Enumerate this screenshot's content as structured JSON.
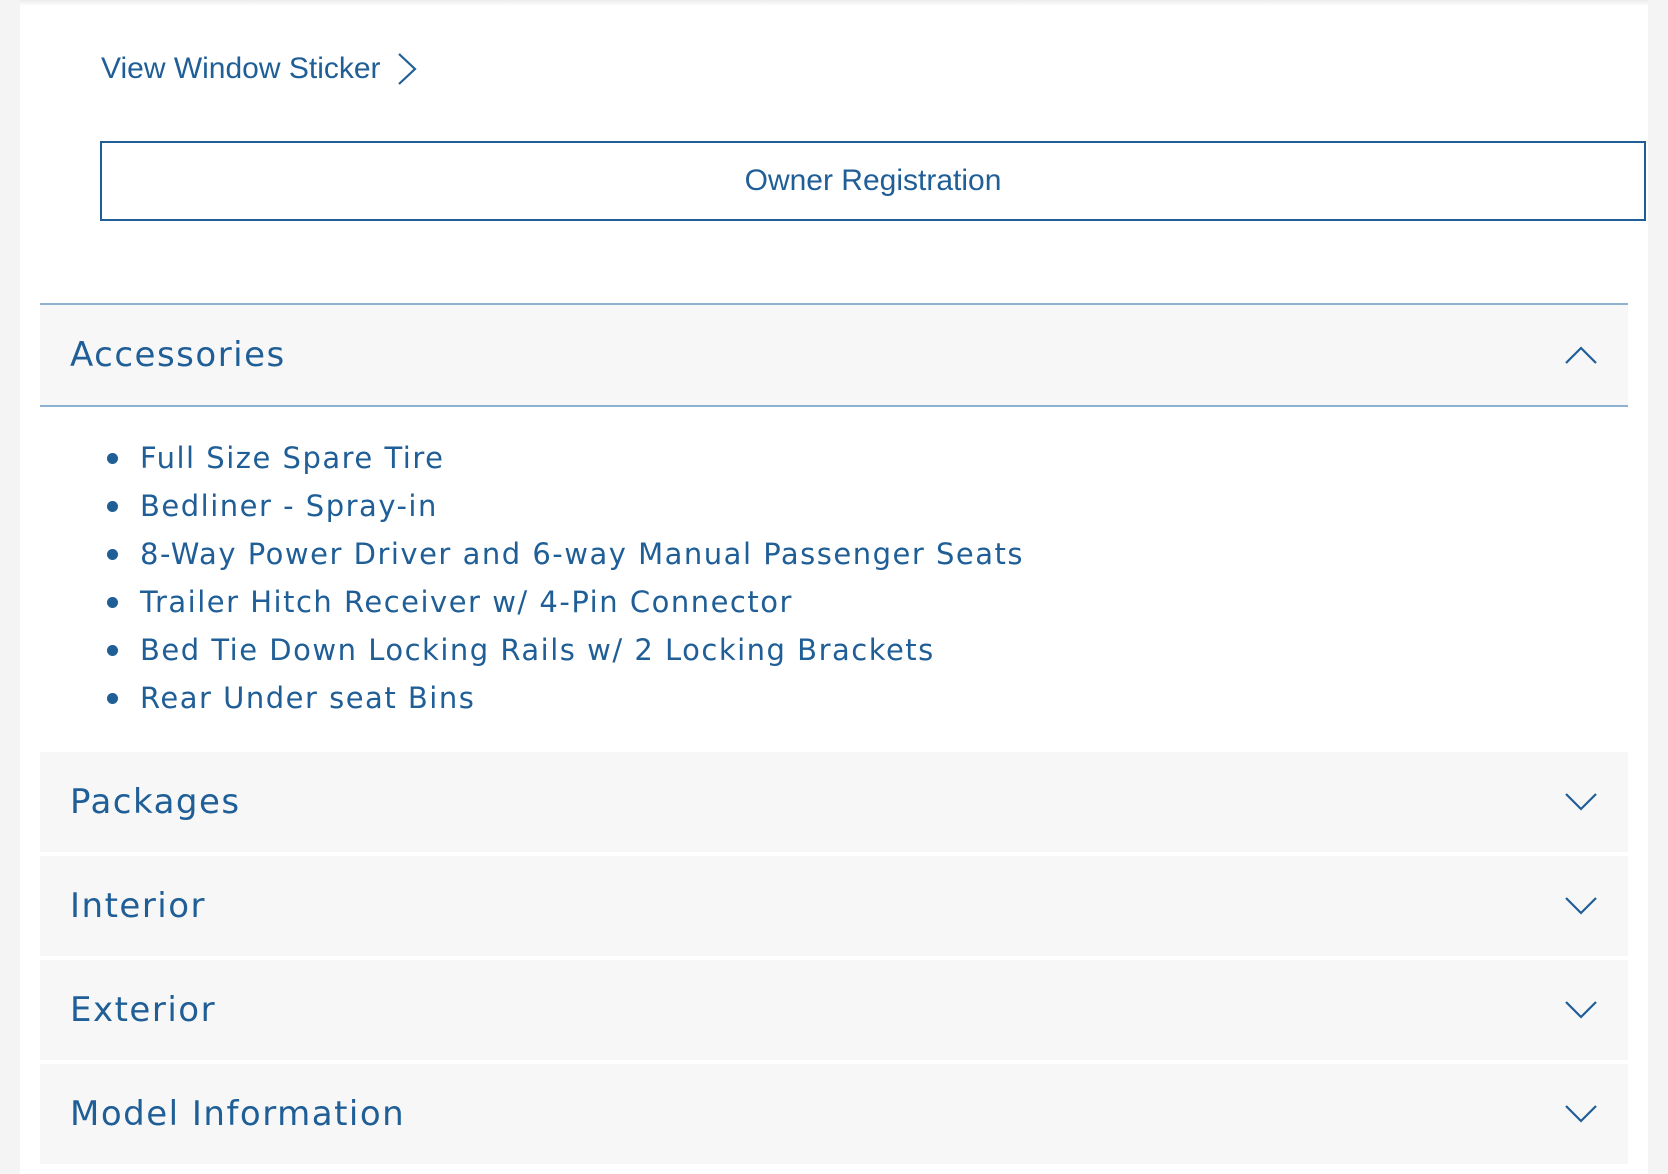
{
  "links": {
    "window_sticker": "View Window Sticker"
  },
  "buttons": {
    "owner_registration": "Owner Registration"
  },
  "colors": {
    "accent": "#1f5e96",
    "section_bg": "#f7f7f7",
    "divider": "#8fb2d2"
  },
  "accordion": {
    "accessories": {
      "label": "Accessories",
      "expanded": true,
      "items": [
        "Full Size Spare Tire",
        "Bedliner - Spray-in",
        "8-Way Power Driver and 6-way Manual Passenger Seats",
        "Trailer Hitch Receiver w/ 4-Pin Connector",
        "Bed Tie Down Locking Rails w/ 2 Locking Brackets",
        "Rear Under seat Bins"
      ]
    },
    "packages": {
      "label": "Packages",
      "expanded": false
    },
    "interior": {
      "label": "Interior",
      "expanded": false
    },
    "exterior": {
      "label": "Exterior",
      "expanded": false
    },
    "model_information": {
      "label": "Model Information",
      "expanded": false
    }
  },
  "icons": {
    "link_chevron": "chevron-right-icon",
    "expanded": "chevron-up-icon",
    "collapsed": "chevron-down-icon"
  }
}
